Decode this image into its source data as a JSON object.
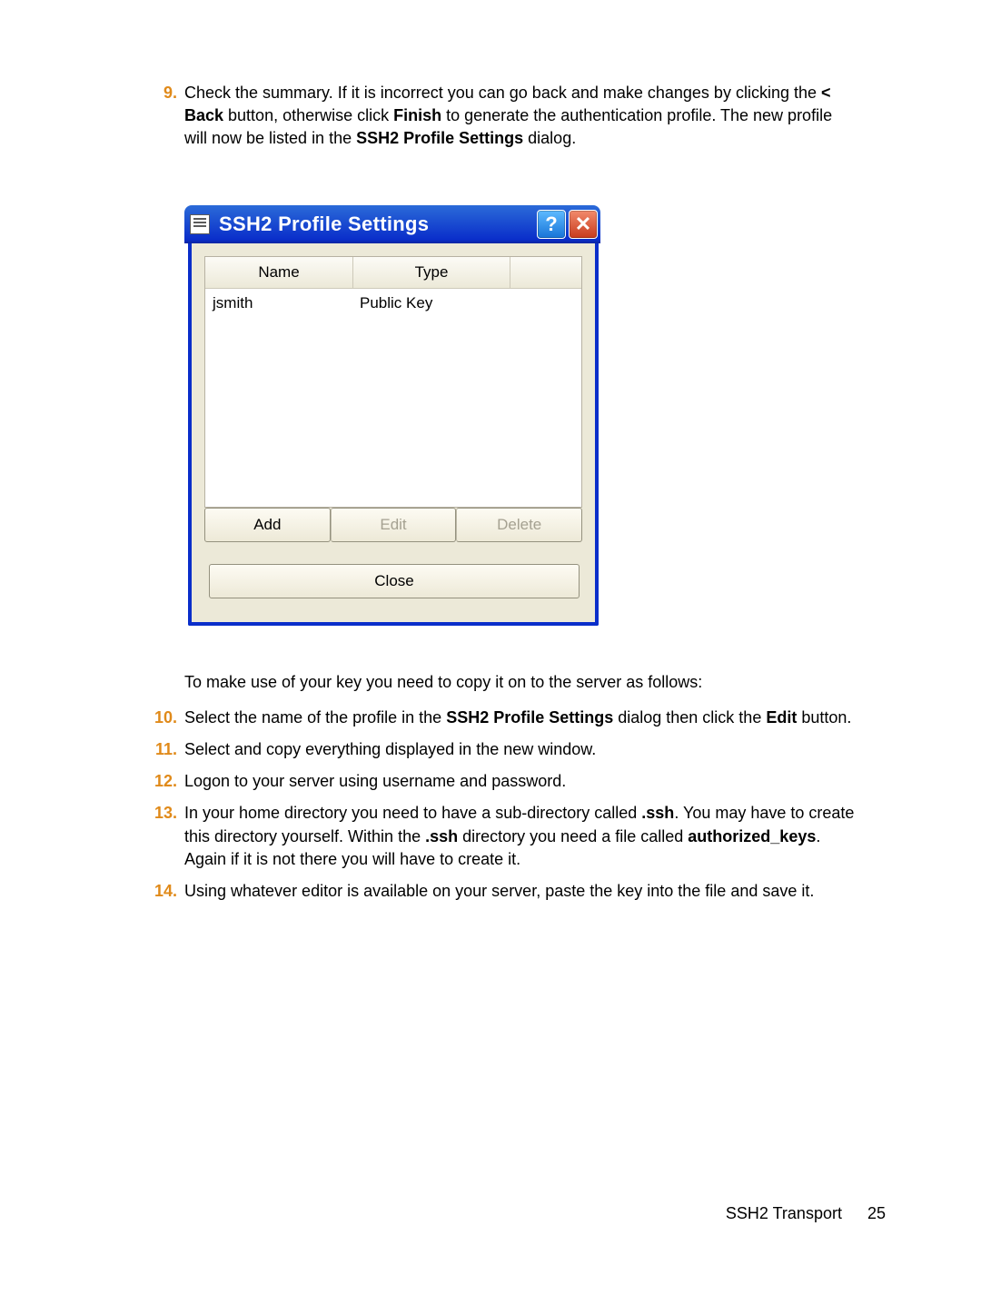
{
  "step9": {
    "num": "9.",
    "t0": "Check the summary. If it is incorrect you can go back and make changes by clicking the ",
    "b0": "< Back",
    "t1": " button, otherwise click ",
    "b1": "Finish",
    "t2": " to generate the authentication profile. The new profile will now be listed in the ",
    "b2": "SSH2 Profile Settings",
    "t3": " dialog."
  },
  "dialog": {
    "title": "SSH2 Profile Settings",
    "columns": {
      "name": "Name",
      "type": "Type"
    },
    "rows": [
      {
        "name": "jsmith",
        "type": "Public Key"
      }
    ],
    "buttons": {
      "add": "Add",
      "edit": "Edit",
      "delete": "Delete",
      "close": "Close"
    }
  },
  "between": "To make use of your key you need to copy it on to the server as follows:",
  "step10": {
    "num": "10.",
    "t0": "Select the name of the profile in the ",
    "b0": "SSH2 Profile Settings",
    "t1": " dialog then click the ",
    "b1": "Edit",
    "t2": " button."
  },
  "step11": {
    "num": "11.",
    "t0": "Select and copy everything displayed in the new window."
  },
  "step12": {
    "num": "12.",
    "t0": "Logon to your server using username and password."
  },
  "step13": {
    "num": "13.",
    "t0": "In your home directory you need to have a sub-directory called ",
    "b0": ".ssh",
    "t1": ". You may have to create this directory yourself. Within the ",
    "b1": ".ssh",
    "t2": " directory you need a file called ",
    "b2": "authorized_keys",
    "t3": ". Again if it is not there you will have to create it."
  },
  "step14": {
    "num": "14.",
    "t0": "Using whatever editor is available on your server, paste the key into the file and save it."
  },
  "footer": {
    "section": "SSH2 Transport",
    "page": "25"
  }
}
